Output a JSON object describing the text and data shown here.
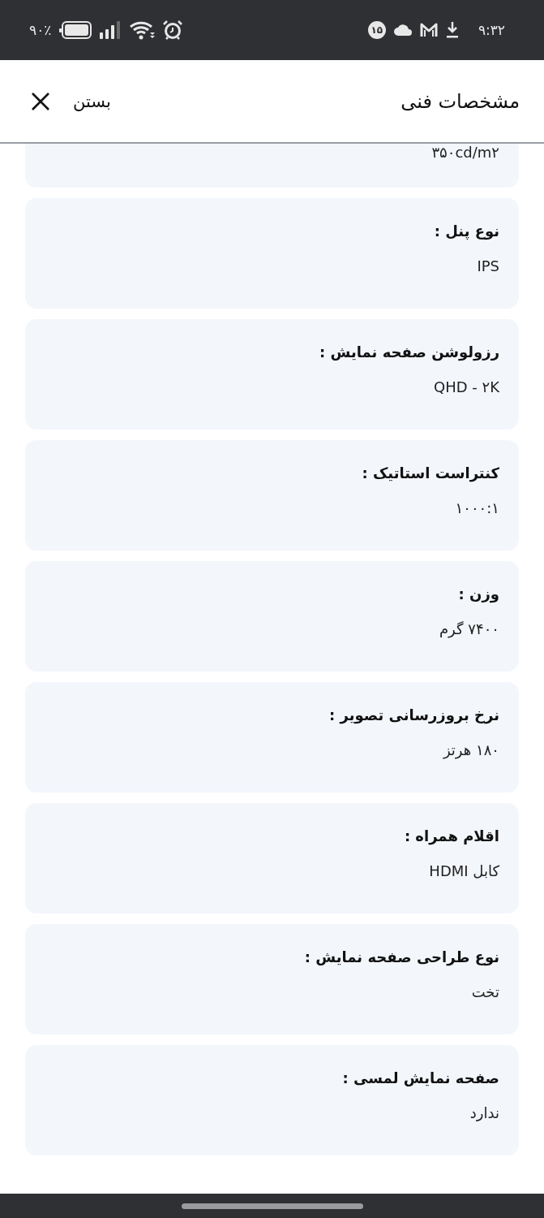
{
  "status_bar": {
    "battery": "۹۰٪",
    "notification_count": "۱۵",
    "time": "۹:۳۲"
  },
  "header": {
    "title": "مشخصات فنی",
    "close_label": "بستن"
  },
  "specs": [
    {
      "value": "۳۵۰cd/m۲"
    },
    {
      "label": "نوع پنل :",
      "value": "IPS"
    },
    {
      "label": "رزولوشن صفحه نمایش :",
      "value": "QHD - ۲K"
    },
    {
      "label": "کنتراست استاتیک :",
      "value": "۱۰۰۰:۱"
    },
    {
      "label": "وزن :",
      "value": "۷۴۰۰ گرم"
    },
    {
      "label": "نرخ بروزرسانی تصویر :",
      "value": "۱۸۰ هرتز"
    },
    {
      "label": "اقلام همراه :",
      "value": "کابل HDMI"
    },
    {
      "label": "نوع طراحی صفحه نمایش :",
      "value": "تخت"
    },
    {
      "label": "صفحه نمایش لمسی :",
      "value": "ندارد"
    }
  ]
}
